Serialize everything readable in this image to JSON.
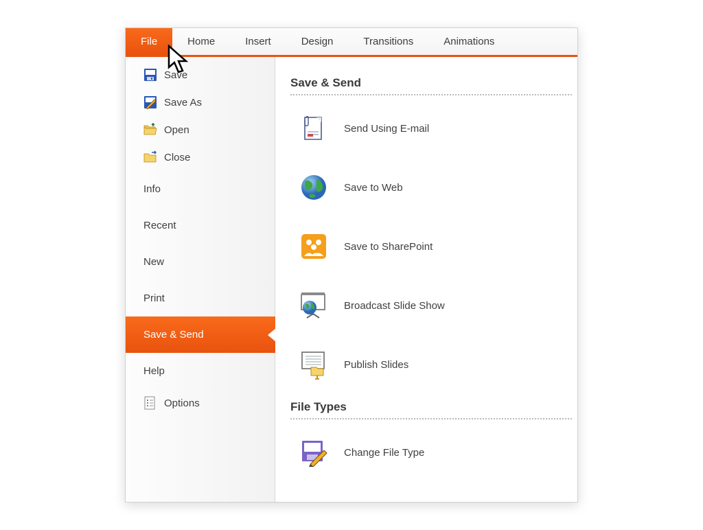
{
  "ribbon": {
    "tabs": [
      {
        "label": "File",
        "active": true
      },
      {
        "label": "Home"
      },
      {
        "label": "Insert"
      },
      {
        "label": "Design"
      },
      {
        "label": "Transitions"
      },
      {
        "label": "Animations"
      }
    ]
  },
  "sidebar": {
    "items": [
      {
        "label": "Save",
        "icon": "save-icon"
      },
      {
        "label": "Save As",
        "icon": "save-as-icon"
      },
      {
        "label": "Open",
        "icon": "open-icon"
      },
      {
        "label": "Close",
        "icon": "close-folder-icon"
      },
      {
        "label": "Info"
      },
      {
        "label": "Recent"
      },
      {
        "label": "New"
      },
      {
        "label": "Print"
      },
      {
        "label": "Save & Send",
        "active": true
      },
      {
        "label": "Help"
      },
      {
        "label": "Options",
        "icon": "options-icon"
      }
    ]
  },
  "content": {
    "sections": [
      {
        "title": "Save & Send",
        "options": [
          {
            "label": "Send Using E-mail",
            "icon": "email-icon"
          },
          {
            "label": "Save to Web",
            "icon": "globe-icon"
          },
          {
            "label": "Save to SharePoint",
            "icon": "sharepoint-icon"
          },
          {
            "label": "Broadcast Slide Show",
            "icon": "broadcast-icon"
          },
          {
            "label": "Publish Slides",
            "icon": "publish-icon"
          }
        ]
      },
      {
        "title": "File Types",
        "options": [
          {
            "label": "Change File Type",
            "icon": "change-file-type-icon"
          }
        ]
      }
    ]
  }
}
